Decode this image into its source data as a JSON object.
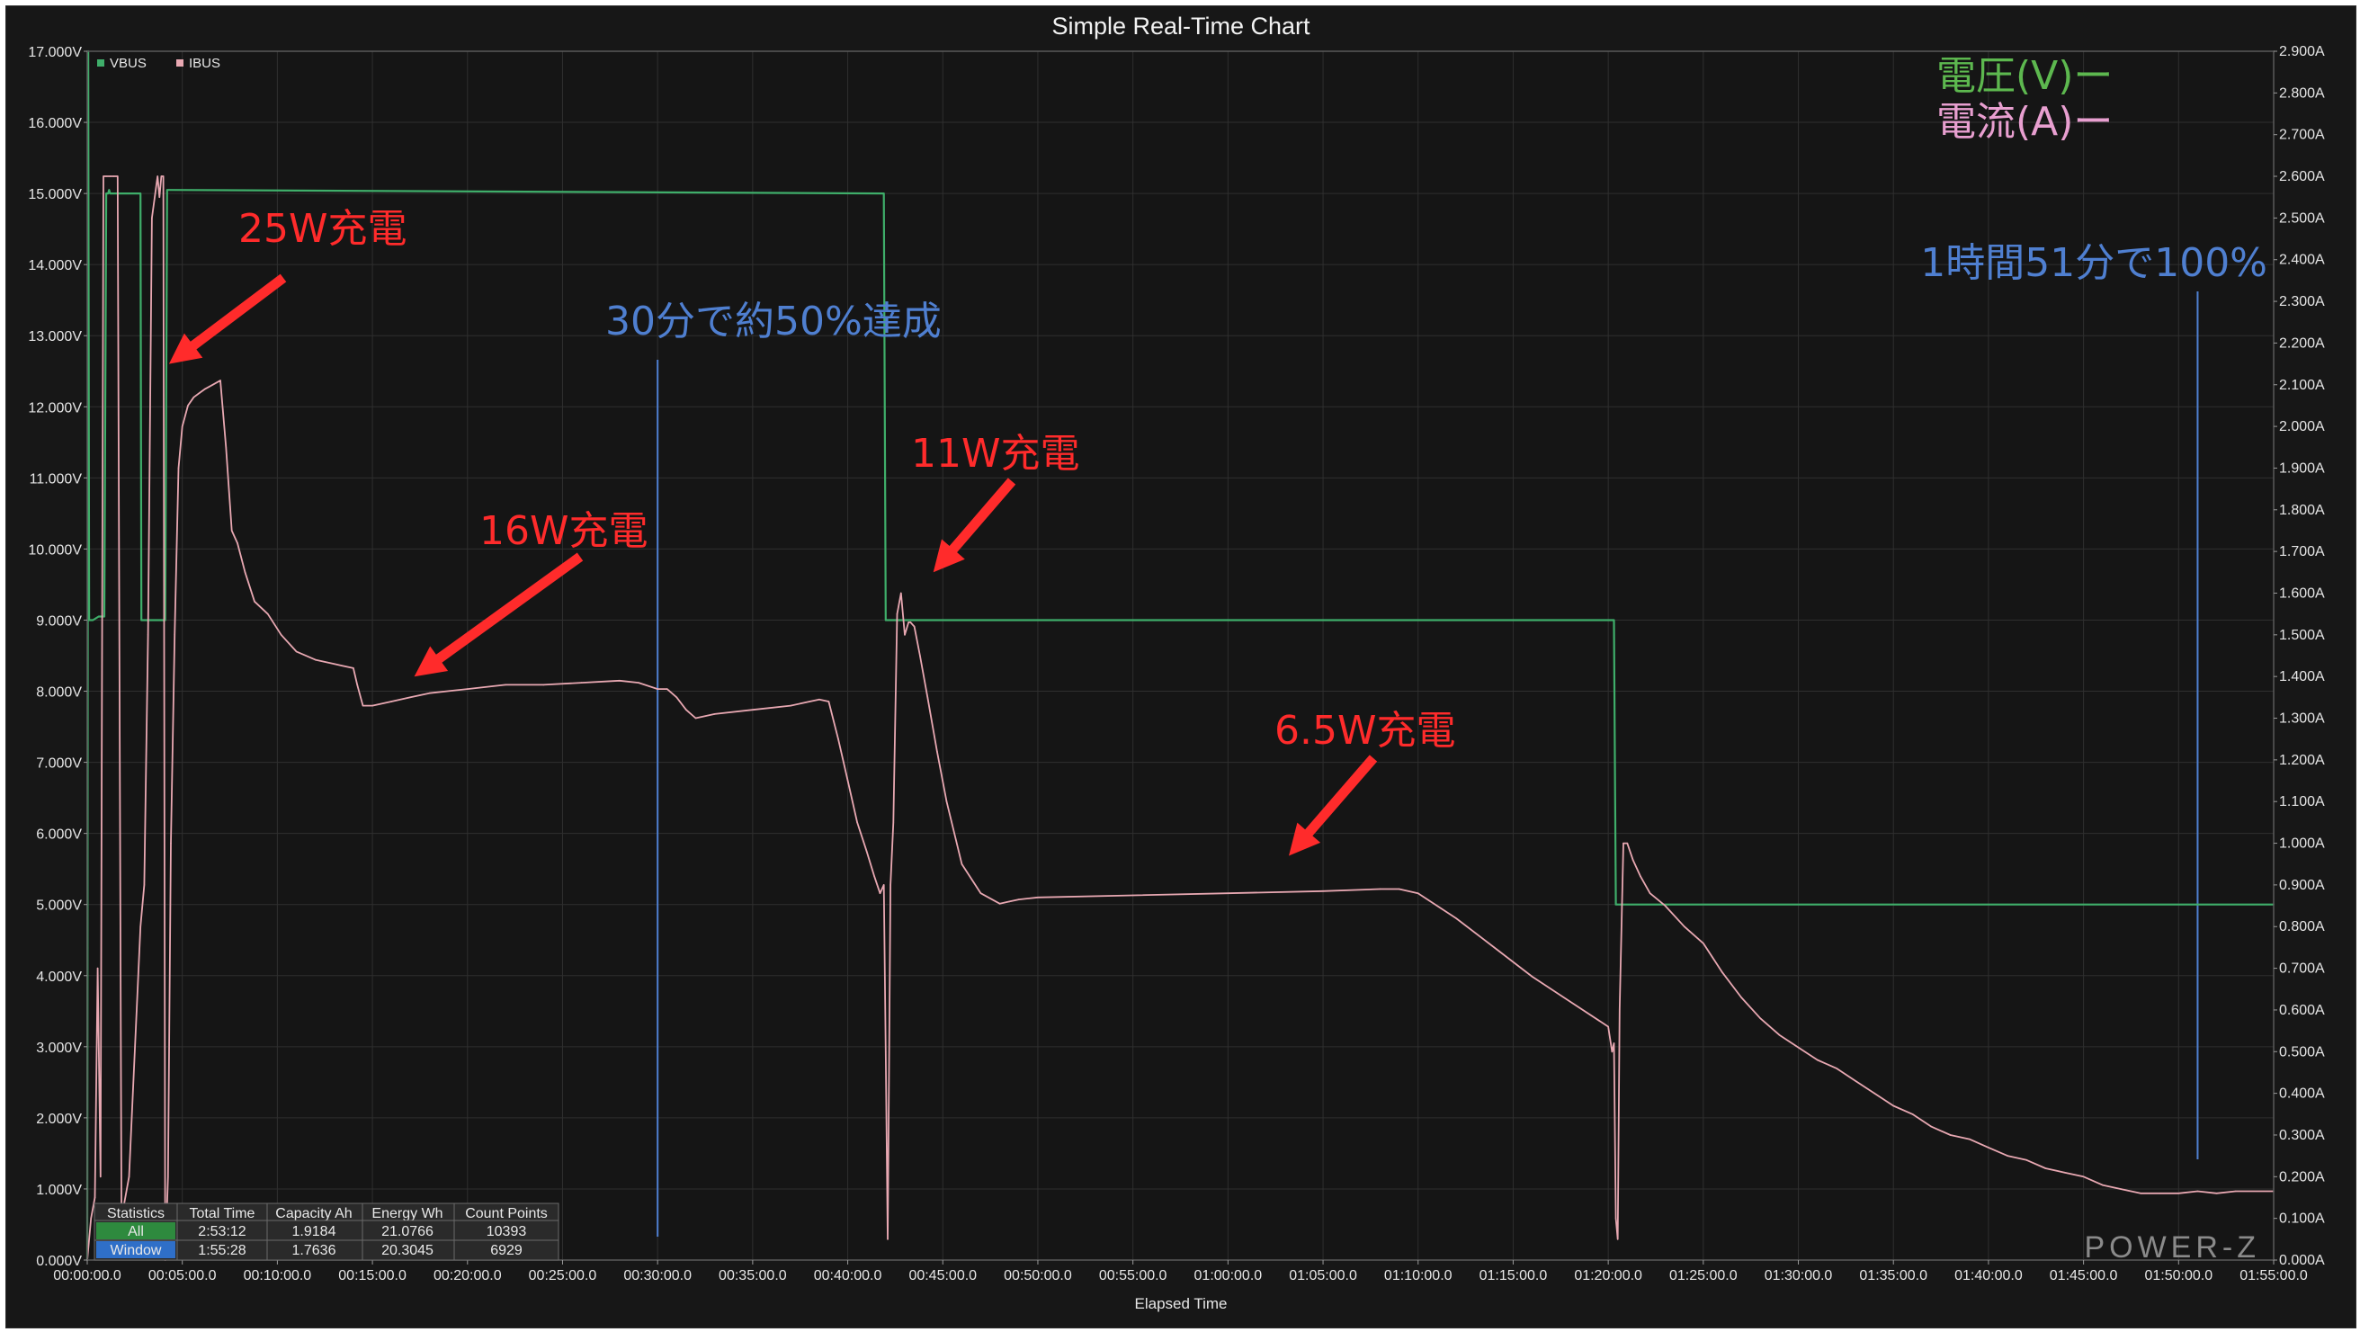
{
  "chart_data": {
    "type": "line",
    "title": "Simple Real-Time Chart",
    "xlabel": "Elapsed Time",
    "x_unit": "minutes",
    "xlim": [
      0,
      115
    ],
    "x_ticks": [
      "00:00:00.0",
      "00:05:00.0",
      "00:10:00.0",
      "00:15:00.0",
      "00:20:00.0",
      "00:25:00.0",
      "00:30:00.0",
      "00:35:00.0",
      "00:40:00.0",
      "00:45:00.0",
      "00:50:00.0",
      "00:55:00.0",
      "01:00:00.0",
      "01:05:00.0",
      "01:10:00.0",
      "01:15:00.0",
      "01:20:00.0",
      "01:25:00.0",
      "01:30:00.0",
      "01:35:00.0",
      "01:40:00.0",
      "01:45:00.0",
      "01:50:00.0",
      "01:55:00.0"
    ],
    "y_left": {
      "min": 0,
      "max": 17,
      "ticks": [
        "17.000V",
        "16.000V",
        "15.000V",
        "14.000V",
        "13.000V",
        "12.000V",
        "11.000V",
        "10.000V",
        "9.000V",
        "8.000V",
        "7.000V",
        "6.000V",
        "5.000V",
        "4.000V",
        "3.000V",
        "2.000V",
        "1.000V",
        "0.000V"
      ]
    },
    "y_right": {
      "min": 0,
      "max": 2.9,
      "ticks": [
        "2.900A",
        "2.800A",
        "2.700A",
        "2.600A",
        "2.500A",
        "2.400A",
        "2.300A",
        "2.200A",
        "2.100A",
        "2.000A",
        "1.900A",
        "1.800A",
        "1.700A",
        "1.600A",
        "1.500A",
        "1.400A",
        "1.300A",
        "1.200A",
        "1.100A",
        "1.000A",
        "0.900A",
        "0.800A",
        "0.700A",
        "0.600A",
        "0.500A",
        "0.400A",
        "0.300A",
        "0.200A",
        "0.100A",
        "0.000A"
      ]
    },
    "grid": true,
    "legend_position": "top-left",
    "series": [
      {
        "name": "VBUS",
        "color": "#3fae6a",
        "axis": "left",
        "x": [
          0,
          0.05,
          0.1,
          0.3,
          0.6,
          0.9,
          1.0,
          1.1,
          1.15,
          1.2,
          2.8,
          2.85,
          2.9,
          4.1,
          4.2,
          4.3,
          41.9,
          42.0,
          42.05,
          80.3,
          80.4,
          80.5,
          115
        ],
        "values": [
          0,
          17.0,
          9.0,
          9.0,
          9.05,
          9.05,
          15.0,
          15.0,
          15.05,
          15.0,
          15.0,
          9.0,
          9.0,
          9.0,
          15.05,
          15.05,
          15.0,
          9.0,
          9.0,
          9.0,
          5.0,
          5.0,
          5.0
        ]
      },
      {
        "name": "IBUS",
        "color": "#e8a8b2",
        "axis": "right",
        "x": [
          0,
          0.2,
          0.4,
          0.55,
          0.7,
          0.85,
          1.0,
          1.2,
          1.4,
          1.6,
          1.8,
          2.2,
          2.8,
          3.0,
          3.2,
          3.4,
          3.7,
          3.8,
          3.9,
          4.0,
          4.1,
          4.25,
          4.4,
          4.6,
          4.8,
          5.0,
          5.3,
          5.6,
          5.9,
          6.2,
          6.6,
          7.0,
          7.3,
          7.6,
          7.9,
          8.3,
          8.8,
          9.5,
          10.2,
          11.0,
          12.0,
          13.0,
          14.0,
          14.2,
          14.5,
          15.0,
          16.0,
          17.0,
          18.0,
          20.0,
          22.0,
          24.0,
          26.0,
          28.0,
          29.0,
          30.0,
          30.5,
          31.0,
          31.5,
          32.0,
          33.0,
          35.0,
          37.0,
          38.0,
          38.5,
          39.0,
          39.5,
          40.0,
          40.5,
          41.0,
          41.4,
          41.7,
          41.9,
          42.0,
          42.1,
          42.25,
          42.4,
          42.6,
          42.8,
          43.0,
          43.2,
          43.3,
          43.5,
          43.8,
          44.2,
          44.7,
          45.2,
          46.0,
          47.0,
          48.0,
          48.5,
          49.0,
          50.0,
          55.0,
          60.0,
          65.0,
          68.0,
          69.0,
          70.0,
          72.0,
          74.0,
          76.0,
          78.0,
          80.0,
          80.2,
          80.3,
          80.4,
          80.5,
          80.6,
          80.8,
          81.0,
          81.3,
          81.7,
          82.2,
          83.0,
          84.0,
          85.0,
          86.0,
          87.0,
          88.0,
          89.0,
          90.0,
          91.0,
          92.0,
          93.0,
          94.0,
          95.0,
          96.0,
          97.0,
          98.0,
          99.0,
          100.0,
          101.0,
          102.0,
          103.0,
          104.0,
          105.0,
          106.0,
          107.0,
          108.0,
          109.0,
          110.0,
          111.0,
          112.0,
          113.0,
          115.0
        ],
        "values": [
          0.0,
          0.1,
          0.15,
          0.7,
          0.2,
          2.6,
          2.6,
          2.6,
          2.6,
          2.6,
          0.1,
          0.2,
          0.8,
          0.9,
          1.5,
          2.5,
          2.6,
          2.55,
          2.6,
          2.6,
          0.0,
          0.2,
          1.0,
          1.5,
          1.9,
          2.0,
          2.05,
          2.07,
          2.08,
          2.09,
          2.1,
          2.11,
          1.95,
          1.75,
          1.72,
          1.65,
          1.58,
          1.55,
          1.5,
          1.46,
          1.44,
          1.43,
          1.42,
          1.38,
          1.33,
          1.33,
          1.34,
          1.35,
          1.36,
          1.37,
          1.38,
          1.38,
          1.385,
          1.39,
          1.385,
          1.37,
          1.37,
          1.35,
          1.32,
          1.3,
          1.31,
          1.32,
          1.33,
          1.34,
          1.345,
          1.34,
          1.25,
          1.15,
          1.05,
          0.98,
          0.92,
          0.88,
          0.9,
          0.5,
          0.05,
          0.9,
          1.05,
          1.55,
          1.6,
          1.5,
          1.53,
          1.53,
          1.52,
          1.45,
          1.35,
          1.22,
          1.1,
          0.95,
          0.88,
          0.855,
          0.86,
          0.865,
          0.87,
          0.875,
          0.88,
          0.885,
          0.89,
          0.89,
          0.88,
          0.82,
          0.75,
          0.68,
          0.62,
          0.56,
          0.5,
          0.52,
          0.1,
          0.05,
          0.6,
          1.0,
          1.0,
          0.96,
          0.92,
          0.88,
          0.85,
          0.8,
          0.76,
          0.69,
          0.63,
          0.58,
          0.54,
          0.51,
          0.48,
          0.46,
          0.43,
          0.4,
          0.37,
          0.35,
          0.32,
          0.3,
          0.29,
          0.27,
          0.25,
          0.24,
          0.22,
          0.21,
          0.2,
          0.18,
          0.17,
          0.16,
          0.16,
          0.16,
          0.165,
          0.16,
          0.165,
          0.165
        ]
      }
    ],
    "markers": [
      {
        "x": 30.0,
        "color": "#4f7fd0"
      },
      {
        "x": 111.0,
        "color": "#4f7fd0"
      }
    ],
    "annotations": [
      {
        "text": "25W充電",
        "color": "#ff2b2b",
        "target_x": 4.3,
        "target_y": 2.15
      },
      {
        "text": "16W充電",
        "color": "#ff2b2b",
        "target_x": 17.2,
        "target_y": 1.4
      },
      {
        "text": "11W充電",
        "color": "#ff2b2b",
        "target_x": 44.5,
        "target_y": 1.65
      },
      {
        "text": "6.5W充電",
        "color": "#ff2b2b",
        "target_x": 63.2,
        "target_y": 0.97
      },
      {
        "text": "30分で約50%達成",
        "color": "#4f7fd0"
      },
      {
        "text": "1時間51分で100%",
        "color": "#4f7fd0"
      }
    ],
    "axis_legend": [
      {
        "text": "電圧(V)ー",
        "color": "#5db84f"
      },
      {
        "text": "電流(A)ー",
        "color": "#e89fd0"
      }
    ]
  },
  "statistics": {
    "headers": [
      "Statistics",
      "Total Time",
      "Capacity Ah",
      "Energy Wh",
      "Count Points"
    ],
    "rows": [
      {
        "label": "All",
        "color": "#2e8a3e",
        "values": [
          "2:53:12",
          "1.9184",
          "21.0766",
          "10393"
        ]
      },
      {
        "label": "Window",
        "color": "#2f6fc8",
        "values": [
          "1:55:28",
          "1.7636",
          "20.3045",
          "6929"
        ]
      }
    ]
  },
  "brand": "POWER-Z"
}
